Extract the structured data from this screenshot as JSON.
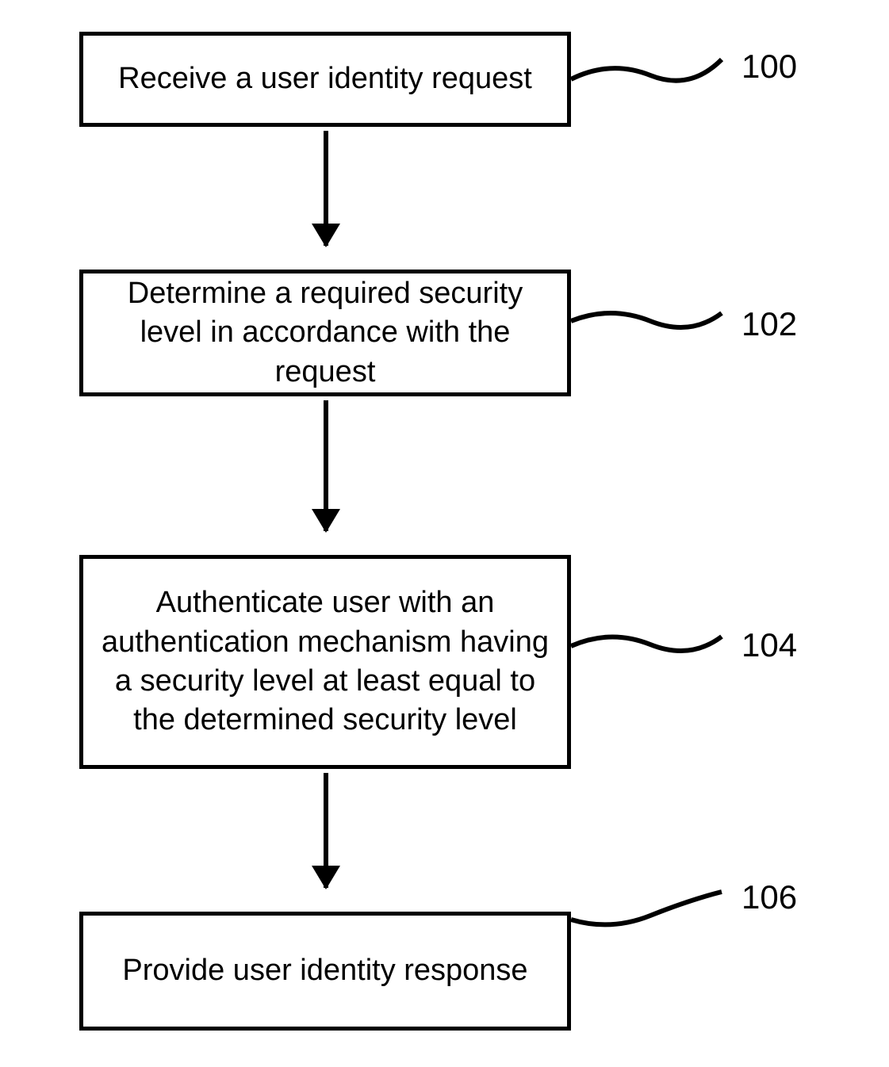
{
  "flowchart": {
    "steps": [
      {
        "id": "100",
        "text": "Receive a user identity request"
      },
      {
        "id": "102",
        "text": "Determine a required security level in accordance with the request"
      },
      {
        "id": "104",
        "text": "Authenticate user with an authentication mechanism having a security level at least equal to the determined security level"
      },
      {
        "id": "106",
        "text": "Provide user identity response"
      }
    ]
  }
}
